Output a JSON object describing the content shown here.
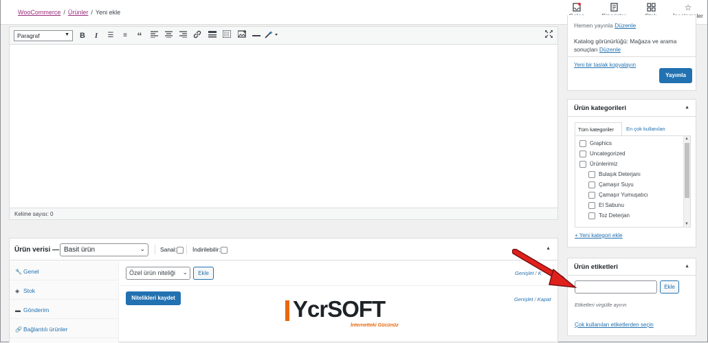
{
  "breadcrumb": {
    "items": [
      "WooCommerce",
      "Ürünler",
      "Yeni ekle"
    ]
  },
  "topnav": {
    "items": [
      {
        "label": "Gelen kutusu",
        "icon": "inbox-icon"
      },
      {
        "label": "Siparişler",
        "icon": "orders-icon"
      },
      {
        "label": "Stok",
        "icon": "stock-icon"
      },
      {
        "label": "İncelemeler",
        "icon": "star-icon"
      }
    ]
  },
  "editor": {
    "format_select": "Paragraf",
    "word_count": "Kelime sayısı: 0",
    "toolbar_icons": [
      "bold-icon",
      "italic-icon",
      "bullet-list-icon",
      "numbered-list-icon",
      "blockquote-icon",
      "align-left-icon",
      "align-center-icon",
      "align-right-icon",
      "link-icon",
      "horizontal-line-icon",
      "toolbar-toggle-icon",
      "add-media-icon",
      "more-icon",
      "magic-wand-icon"
    ]
  },
  "product_data": {
    "title": "Ürün verisi —",
    "type_select": "Basit ürün",
    "virtual_label": "Sanal:",
    "downloadable_label": "İndirilebilir:",
    "tabs": [
      {
        "label": "Genel",
        "icon": "wrench-icon"
      },
      {
        "label": "Stok",
        "icon": "tag-icon"
      },
      {
        "label": "Gönderim",
        "icon": "truck-icon"
      },
      {
        "label": "Bağlantılı ürünler",
        "icon": "link-icon"
      }
    ],
    "attribute_select": "Özel ürün niteliği",
    "add_button": "Ekle",
    "save_attributes_button": "Nitelikleri kaydet",
    "expand_label": "Genişlet",
    "close_label": "Kapat",
    "expand_sep": "/",
    "expand_close_partial": "K"
  },
  "logo": {
    "text": "YcrSOFT",
    "tagline": "İnternetteki Gücünüz"
  },
  "publish_box": {
    "visibility_partial": "Hemen yayınla",
    "visibility_edit": "Düzenle",
    "catalog_text": "Katalog görünürlüğü: Mağaza ve arama sonuçları",
    "catalog_edit": "Düzenle",
    "draft_link": "Yeni bir taslak kopyalayın",
    "publish_button": "Yayımla"
  },
  "categories_box": {
    "title": "Ürün kategorileri",
    "tab_all": "Tüm kategoriler",
    "tab_popular": "En çok kullanılan",
    "items": [
      {
        "label": "Graphics",
        "level": 0
      },
      {
        "label": "Uncategorized",
        "level": 0
      },
      {
        "label": "Ürünlerimiz",
        "level": 0
      },
      {
        "label": "Bulaşık Deterjanı",
        "level": 1
      },
      {
        "label": "Çamaşır Suyu",
        "level": 1
      },
      {
        "label": "Çamaşır Yumuşatıcı",
        "level": 1
      },
      {
        "label": "El Sabunu",
        "level": 1
      },
      {
        "label": "Toz Deterjan",
        "level": 1
      }
    ],
    "add_link": "+ Yeni kategori ekle"
  },
  "tags_box": {
    "title": "Ürün etiketleri",
    "input_value": "",
    "add_button": "Ekle",
    "help": "Etiketleri virgülle ayırın",
    "popular_link": "Çok kullanılan etiketlerden seçin"
  },
  "colors": {
    "accent": "#2271b1",
    "brand_link": "#9b2a7d",
    "logo_orange": "#e8680f",
    "arrow_red": "#e0201b"
  }
}
